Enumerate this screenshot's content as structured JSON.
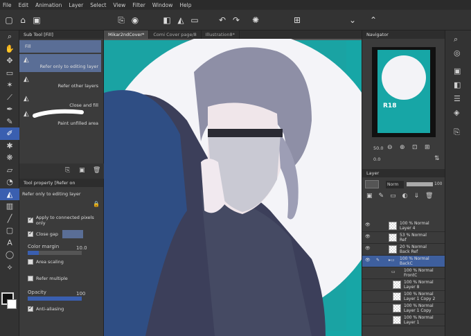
{
  "menu": [
    "File",
    "Edit",
    "Animation",
    "Layer",
    "Select",
    "View",
    "Filter",
    "Window",
    "Help"
  ],
  "subtool": {
    "title": "Sub Tool [Fill]",
    "items": [
      "Fill",
      "Refer only to editing layer",
      "Refer other layers",
      "Close and fill",
      "Paint unfilled area"
    ]
  },
  "toolprop": {
    "title": "Tool property [Refer on",
    "subtitle": "Refer only to editing layer",
    "apply_connected": "Apply to connected pixels only",
    "close_gap": "Close gap",
    "color_margin_label": "Color margin",
    "color_margin_value": "10.0",
    "area_scaling": "Area scaling",
    "refer_multiple": "Refer multiple",
    "opacity_label": "Opacity",
    "opacity_value": "100",
    "anti_aliasing": "Anti-aliasing"
  },
  "tabs": [
    "Mikar2ndCover*",
    "Comi Cover page/8",
    "Illustration8*"
  ],
  "navigator": {
    "title": "Navigator",
    "zoom": "50.0",
    "angle": "0.0",
    "cover_text": "R18"
  },
  "layer": {
    "title": "Layer",
    "blend_mode": "Norm",
    "opacity": "100",
    "rows": [
      {
        "pct": "100 % Normal",
        "name": "Layer 4"
      },
      {
        "pct": "53 % Normal",
        "name": "Ref"
      },
      {
        "pct": "20 % Normal",
        "name": "Back Ref"
      },
      {
        "pct": "100 % Normal",
        "name": "BackC"
      },
      {
        "pct": "100 % Normal",
        "name": "FrontC"
      },
      {
        "pct": "100 % Normal",
        "name": "Layer 8"
      },
      {
        "pct": "100 % Normal",
        "name": "Layer 1 Copy 2"
      },
      {
        "pct": "100 % Normal",
        "name": "Layer 1 Copy"
      },
      {
        "pct": "100 % Normal",
        "name": "Layer 1"
      }
    ]
  },
  "colors": {
    "accent": "#3a5fb0",
    "teal_bg": "#1aa3a3",
    "panel": "#3b3b3b"
  }
}
